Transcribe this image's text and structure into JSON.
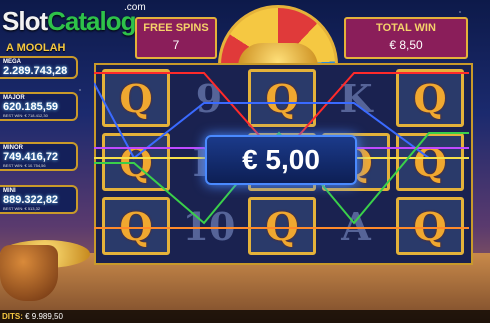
{
  "logo": {
    "main_a": "Slot",
    "main_b": "Catalog",
    "com": ".com",
    "sub": "A MOOLAH"
  },
  "jackpots": [
    {
      "name": "MEGA",
      "value": "2.289.743,28",
      "best": ""
    },
    {
      "name": "MAJOR",
      "value": "620.185,59",
      "best": "BEST WIN: € 718.412,30"
    },
    {
      "name": "MINOR",
      "value": "749.416,72",
      "best": "BEST WIN: € 10.754,56"
    },
    {
      "name": "MINI",
      "value": "889.322,82",
      "best": "BEST WIN: € 513,32"
    }
  ],
  "free_spins": {
    "label": "FREE SPINS",
    "value": "7"
  },
  "total_win": {
    "label": "TOTAL WIN",
    "value": "€ 8,50"
  },
  "win_amount": "€ 5,00",
  "reels": {
    "symbols": [
      [
        "Q",
        "9",
        "Q",
        "K",
        "Q"
      ],
      [
        "Q",
        "K",
        "Q",
        "Q",
        "Q"
      ],
      [
        "Q",
        "10",
        "Q",
        "A",
        "Q"
      ]
    ]
  },
  "bottom": {
    "credits_label": "DITS:",
    "credits_value": "€ 9.989,50"
  },
  "colors": {
    "accent_gold": "#e4b23a",
    "panel": "#8a1e5a",
    "win_blue": "#4a8aff"
  }
}
